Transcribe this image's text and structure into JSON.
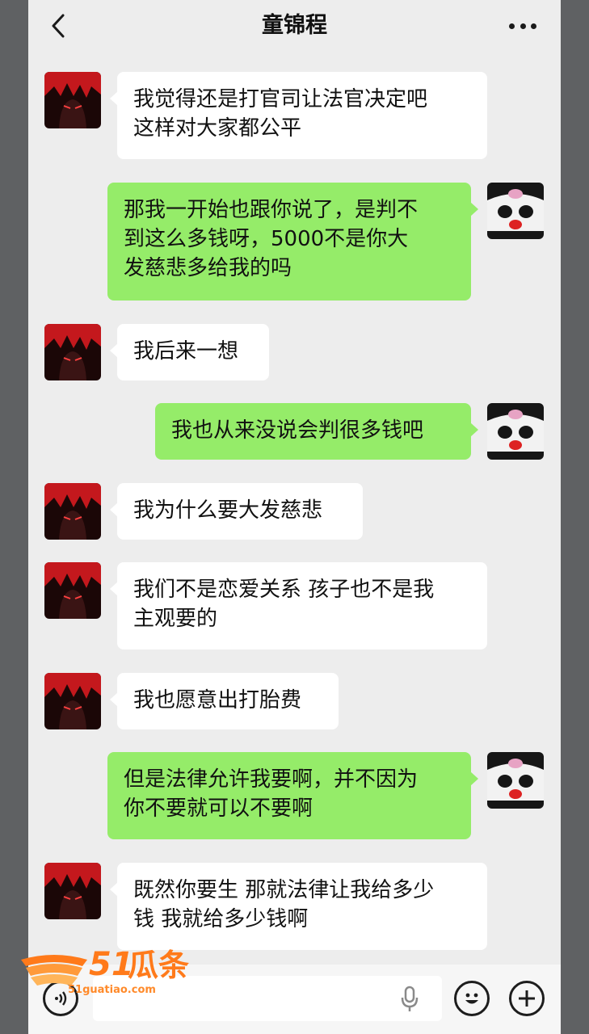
{
  "header": {
    "title": "童锦程"
  },
  "messages": [
    {
      "side": "left",
      "text": "我觉得还是打官司让法官决定吧\n这样对大家都公平"
    },
    {
      "side": "right",
      "text": "那我一开始也跟你说了，是判不\n到这么多钱呀，5000不是你大\n发慈悲多给我的吗"
    },
    {
      "side": "left",
      "text": "我后来一想"
    },
    {
      "side": "right",
      "text": "我也从来没说会判很多钱吧"
    },
    {
      "side": "left",
      "text": "我为什么要大发慈悲"
    },
    {
      "side": "left",
      "text": "我们不是恋爱关系 孩子也不是我\n主观要的"
    },
    {
      "side": "left",
      "text": "我也愿意出打胎费"
    },
    {
      "side": "right",
      "text": "但是法律允许我要啊，并不因为\n你不要就可以不要啊"
    },
    {
      "side": "left",
      "text": "既然你要生 那就法律让我给多少\n钱 我就给多少钱啊"
    }
  ],
  "input_bar": {
    "placeholder": "",
    "icons": [
      "voice-icon",
      "mic-icon",
      "emoji-icon",
      "plus-icon"
    ]
  },
  "watermark": {
    "number": "51",
    "logo_text": "瓜条",
    "domain": "51guatiao.com"
  },
  "colors": {
    "background": "#ededed",
    "outgoing_bubble": "#95ec69",
    "incoming_bubble": "#ffffff",
    "watermark": "#ff7a1a"
  }
}
